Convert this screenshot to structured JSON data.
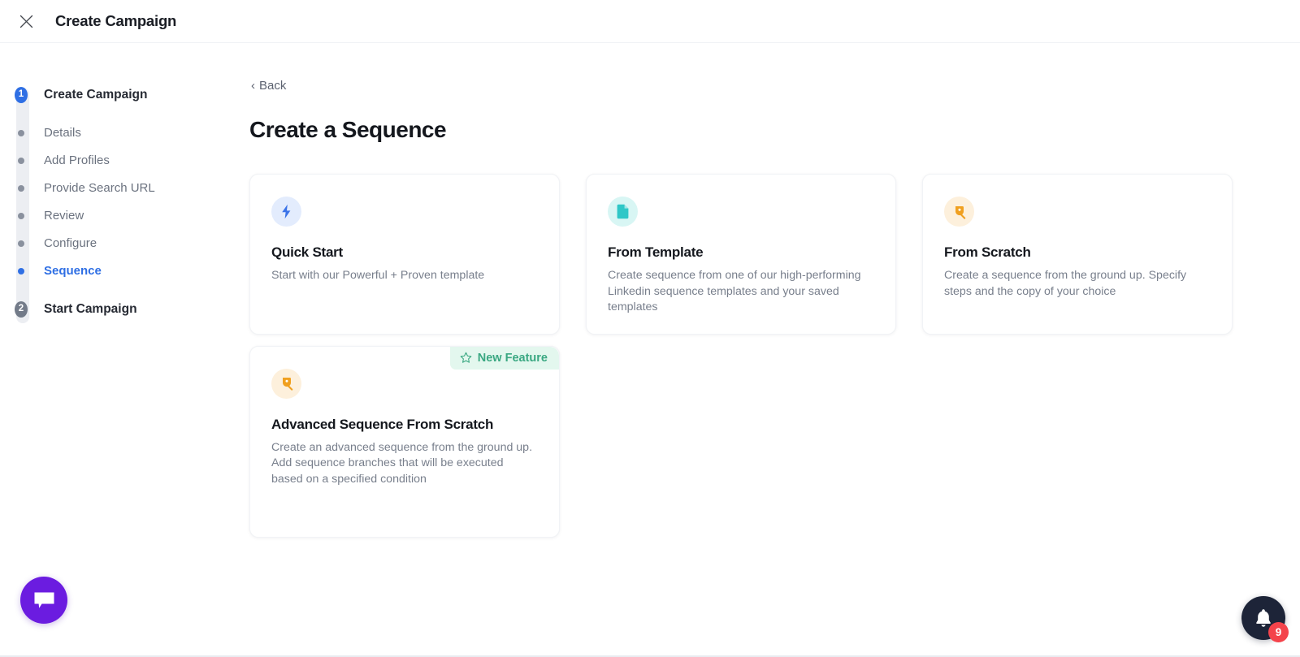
{
  "header": {
    "title": "Create Campaign",
    "close_icon": "close-icon"
  },
  "sidebar": {
    "steps": [
      {
        "type": "major",
        "number": "1",
        "label": "Create Campaign",
        "state": "active"
      },
      {
        "type": "sub",
        "label": "Details",
        "state": "done"
      },
      {
        "type": "sub",
        "label": "Add Profiles",
        "state": "done"
      },
      {
        "type": "sub",
        "label": "Provide Search URL",
        "state": "done"
      },
      {
        "type": "sub",
        "label": "Review",
        "state": "done"
      },
      {
        "type": "sub",
        "label": "Configure",
        "state": "done"
      },
      {
        "type": "sub",
        "label": "Sequence",
        "state": "current"
      },
      {
        "type": "major",
        "number": "2",
        "label": "Start Campaign",
        "state": "inactive"
      }
    ]
  },
  "main": {
    "back_label": "Back",
    "back_chevron": "chevron-left-icon",
    "page_title": "Create a Sequence",
    "cards": [
      {
        "icon": "lightning-bolt-icon",
        "icon_color": "blue",
        "title": "Quick Start",
        "description": "Start with our Powerful + Proven template"
      },
      {
        "icon": "document-icon",
        "icon_color": "teal",
        "title": "From Template",
        "description": "Create sequence from one of our high-performing Linkedin sequence templates and your saved templates"
      },
      {
        "icon": "pen-nib-icon",
        "icon_color": "orange",
        "title": "From Scratch",
        "description": "Create a sequence from the ground up. Specify steps and the copy of your choice"
      },
      {
        "icon": "pen-nib-icon",
        "icon_color": "orange",
        "title": "Advanced Sequence From Scratch",
        "description": "Create an advanced sequence from the ground up.\nAdd sequence branches that will be executed based on a specified condition",
        "badge": "New Feature",
        "badge_icon": "star-icon"
      }
    ]
  },
  "widgets": {
    "chat": {
      "icon": "chat-bubble-icon"
    },
    "notifications": {
      "icon": "bell-icon",
      "count": "9"
    }
  },
  "colors": {
    "accent_blue": "#2f6fe4",
    "badge_green_bg": "#e3f7ee",
    "badge_green_text": "#3aa882",
    "chat_purple": "#6b1ce0",
    "notif_dark": "#1d2438",
    "notif_red": "#f4434b"
  }
}
